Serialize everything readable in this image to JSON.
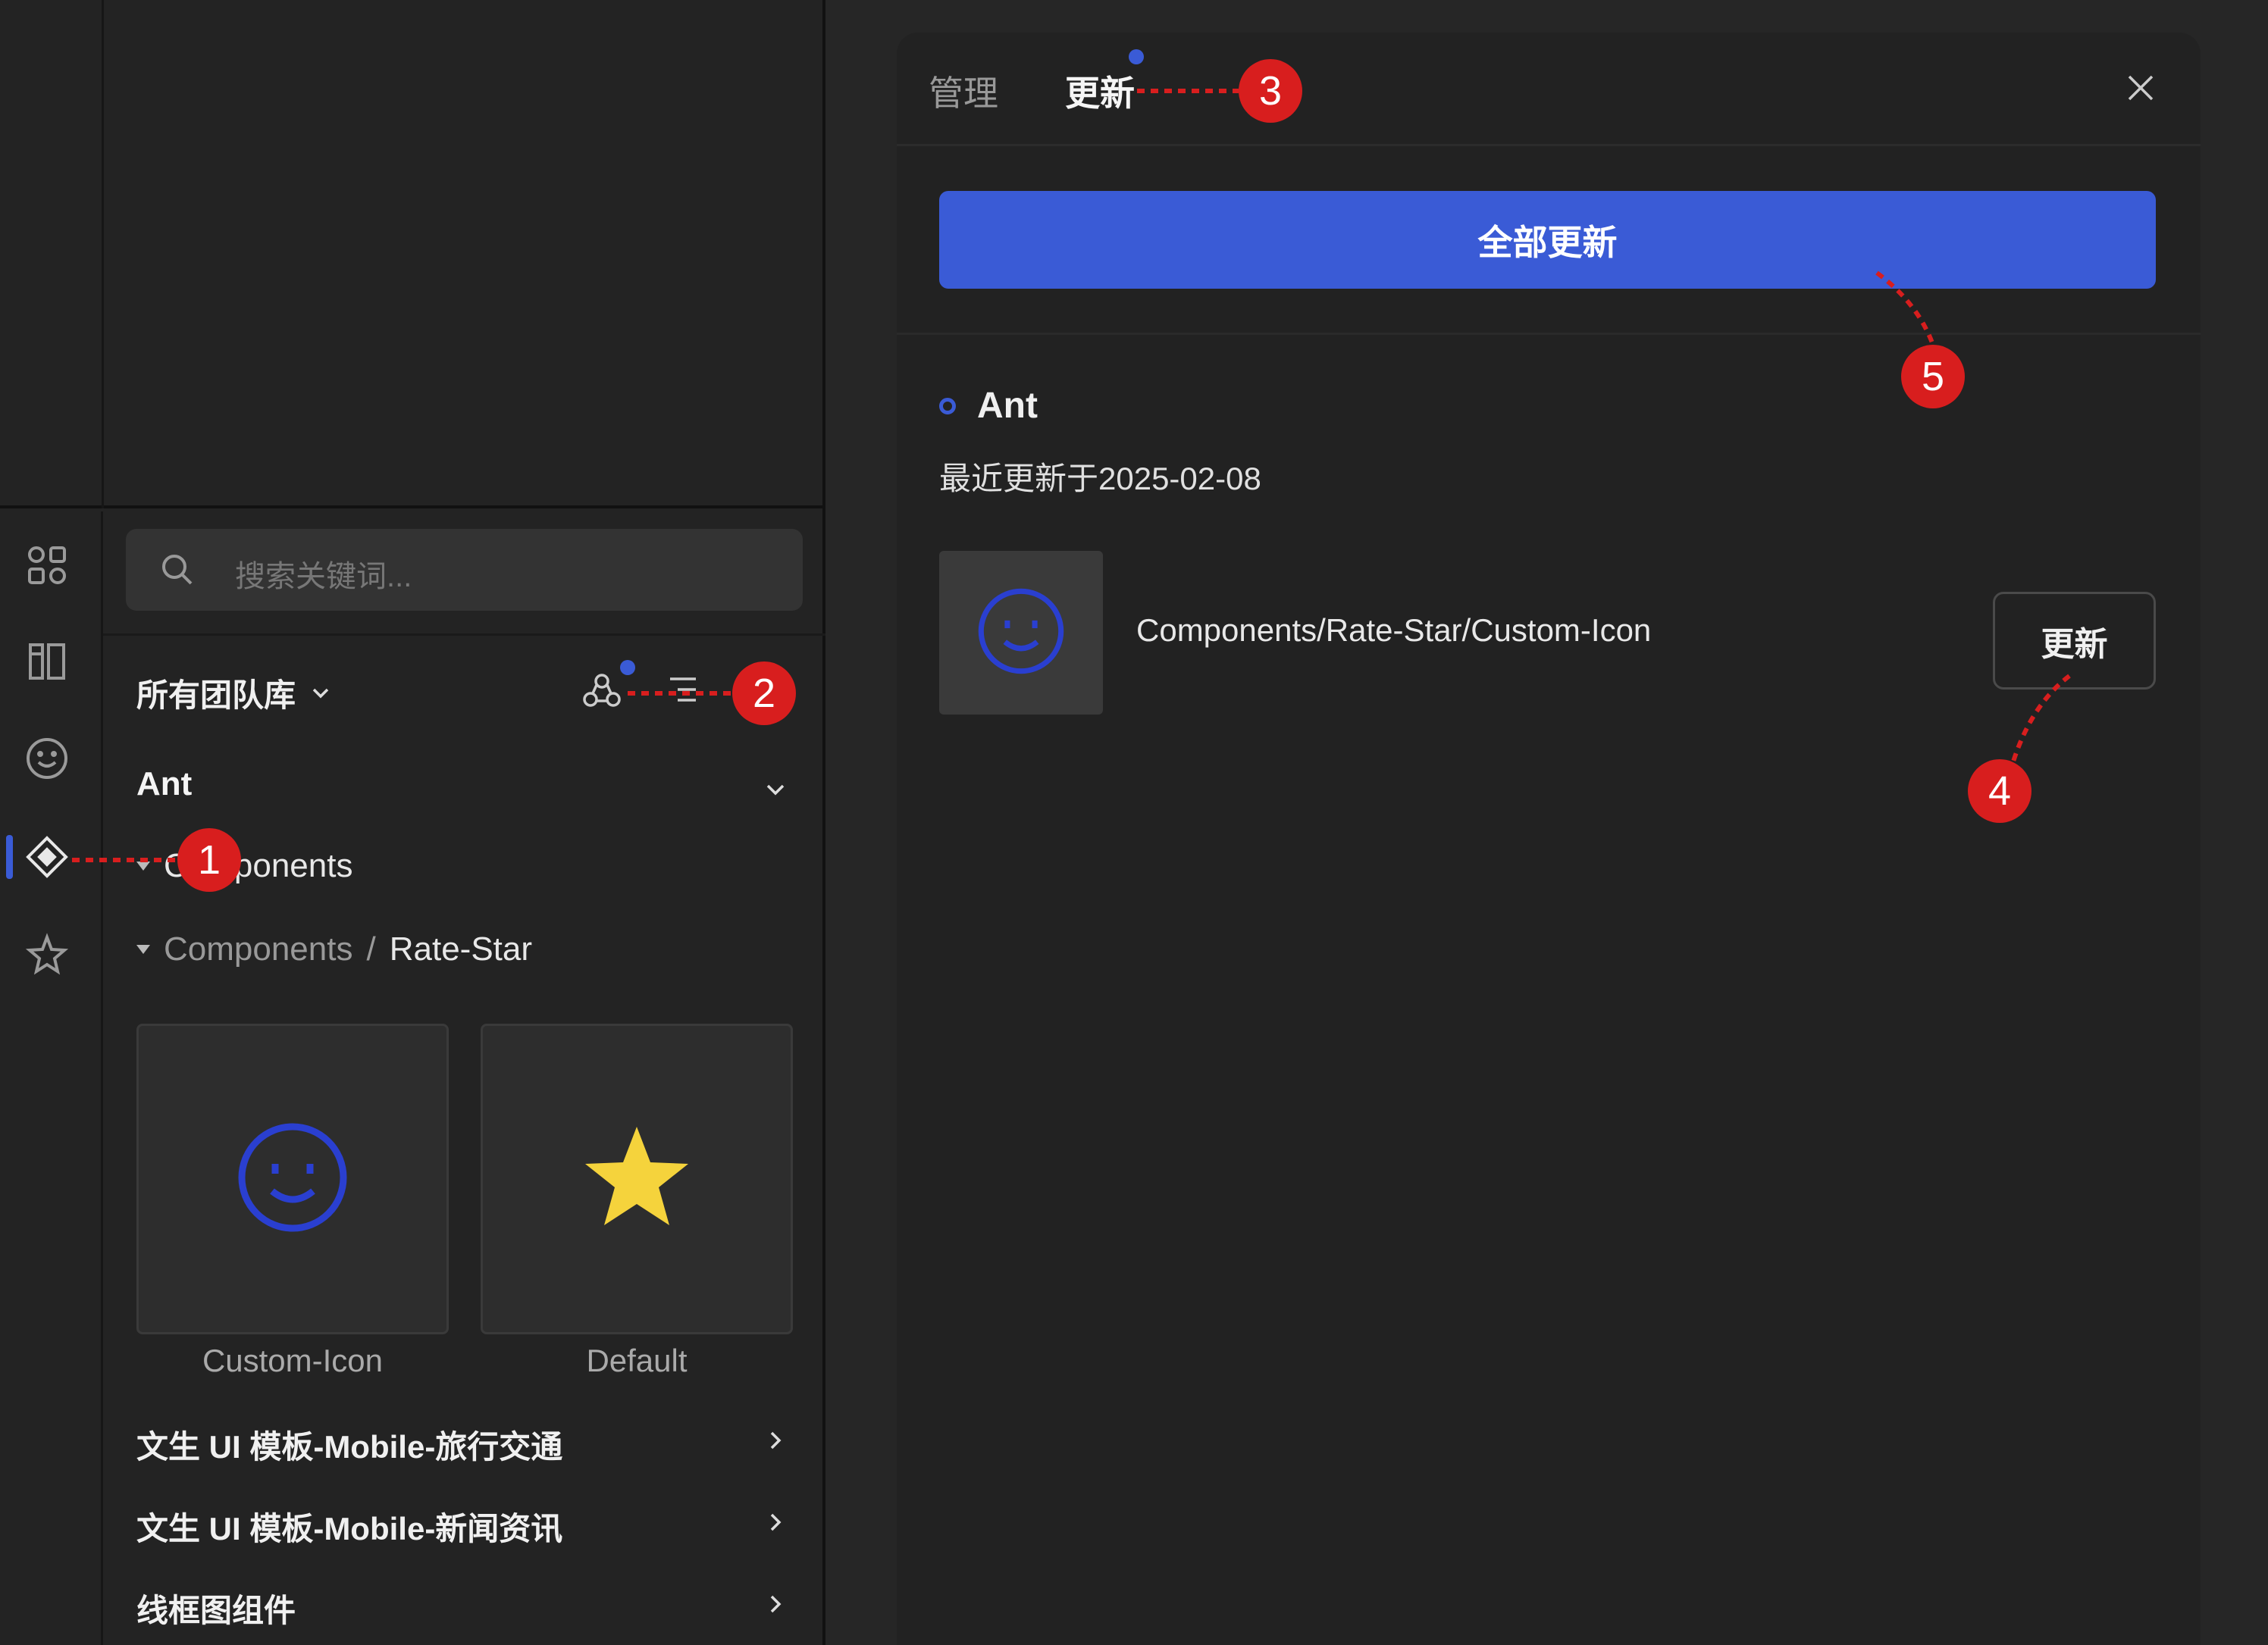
{
  "left": {
    "search_placeholder": "搜索关键词...",
    "team_library_selector": "所有团队库",
    "library_name": "Ant",
    "tree": {
      "group_label": "Components",
      "path_parent": "Components",
      "path_separator": "/",
      "path_current": "Rate-Star"
    },
    "cards": [
      {
        "label": "Custom-Icon",
        "icon": "smiley-icon"
      },
      {
        "label": "Default",
        "icon": "star-icon"
      }
    ],
    "libraries": [
      {
        "label": "文生 UI 模板-Mobile-旅行交通"
      },
      {
        "label": "文生 UI 模板-Mobile-新闻资讯"
      },
      {
        "label": "线框图组件"
      }
    ],
    "rail_icons": [
      "components-grid-icon",
      "layout-icon",
      "emoji-icon",
      "component-diamond-icon",
      "star-badge-icon"
    ]
  },
  "right": {
    "tabs": [
      {
        "label": "管理"
      },
      {
        "label": "更新"
      }
    ],
    "update_all_label": "全部更新",
    "library": {
      "name": "Ant",
      "updated_text": "最近更新于2025-02-08",
      "component_path": "Components/Rate-Star/Custom-Icon",
      "update_label": "更新"
    }
  },
  "callouts": [
    "1",
    "2",
    "3",
    "4",
    "5"
  ],
  "colors": {
    "accent": "#3a5bd6",
    "callout": "#d81e1e",
    "star": "#f5d33c",
    "smiley": "#2a3fd0"
  }
}
